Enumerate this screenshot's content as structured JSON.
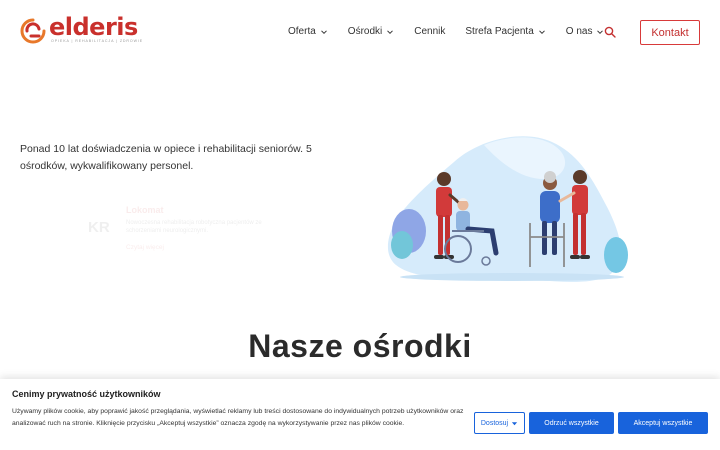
{
  "brand": {
    "name": "elderis",
    "tagline": "OPIEKA | REHABILITACJA | ZDROWIE",
    "accent": "#c9302c"
  },
  "nav": {
    "items": [
      {
        "label": "Oferta",
        "has_dropdown": true
      },
      {
        "label": "Ośrodki",
        "has_dropdown": true
      },
      {
        "label": "Cennik",
        "has_dropdown": false
      },
      {
        "label": "Strefa Pacjenta",
        "has_dropdown": true
      },
      {
        "label": "O nas",
        "has_dropdown": true
      }
    ],
    "search_icon": "search-icon",
    "contact_label": "Kontakt"
  },
  "hero": {
    "text": "Ponad 10 lat doświadczenia w opiece i rehabilitacji seniorów. 5 ośrodków, wykwalifikowany personel."
  },
  "ghost_card": {
    "badge": "KR",
    "title": "Lokomat",
    "description": "Nowoczesna rehabilitacja robotyczna pacjentów ze schorzeniami neurologicznymi.",
    "more": "Czytaj więcej"
  },
  "sections": {
    "centers_title": "Nasze ośrodki"
  },
  "cookie_banner": {
    "title": "Cenimy prywatność użytkowników",
    "text": "Używamy plików cookie, aby poprawić jakość przeglądania, wyświetlać reklamy lub treści dostosowane do indywidualnych potrzeb użytkowników oraz analizować ruch na stronie. Kliknięcie przycisku „Akceptuj wszystkie” oznacza zgodę na wykorzystywanie przez nas plików cookie.",
    "customize_label": "Dostosuj",
    "reject_label": "Odrzuć wszystkie",
    "accept_label": "Akceptuj wszystkie",
    "button_color": "#1863dc"
  }
}
